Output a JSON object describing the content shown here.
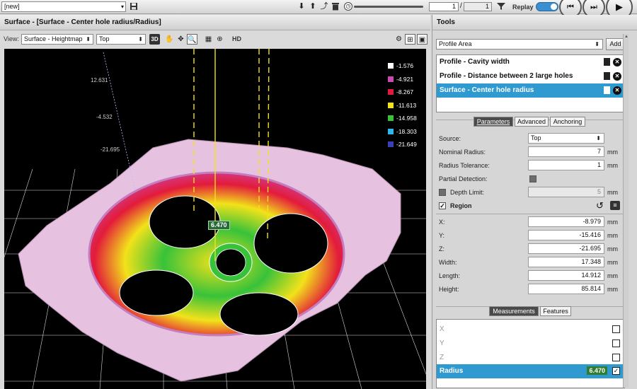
{
  "topbar": {
    "job_select": "[new]",
    "frame_current": "1",
    "frame_total": "1",
    "replay_label": "Replay"
  },
  "view_panel": {
    "title": "Surface - [Surface - Center hole radius/Radius]",
    "view_label": "View:",
    "view_mode": "Surface - Heightmap",
    "view_source": "Top",
    "btn_3d": "3D",
    "btn_hd": "HD"
  },
  "legend": [
    {
      "label": "-1.576",
      "color": "#ffffff"
    },
    {
      "label": "-4.921",
      "color": "#c84bb0"
    },
    {
      "label": "-8.267",
      "color": "#e31b3a"
    },
    {
      "label": "-11.613",
      "color": "#f2e21a"
    },
    {
      "label": "-14.958",
      "color": "#38c23a"
    },
    {
      "label": "-18.303",
      "color": "#2fb7e8"
    },
    {
      "label": "-21.649",
      "color": "#3a3fb5"
    }
  ],
  "axis_labels": [
    "12.631",
    "-4.532",
    "-21.695"
  ],
  "measurement_tag": "6.470",
  "tools": {
    "title": "Tools",
    "area_select": "Profile Area",
    "add_label": "Add",
    "items": [
      {
        "label": "Profile - Cavity width"
      },
      {
        "label": "Profile - Distance between 2 large holes"
      },
      {
        "label": "Surface - Center hole radius"
      }
    ]
  },
  "config_tabs": [
    "Parameters",
    "Advanced",
    "Anchoring"
  ],
  "params": {
    "source_label": "Source:",
    "source_value": "Top",
    "nominal_label": "Nominal Radius:",
    "nominal_value": "7",
    "tolerance_label": "Radius Tolerance:",
    "tolerance_value": "1",
    "partial_label": "Partial Detection:",
    "depth_label": "Depth Limit:",
    "depth_value": "5",
    "region_label": "Region",
    "unit": "mm",
    "region": [
      {
        "label": "X:",
        "value": "-8.979"
      },
      {
        "label": "Y:",
        "value": "-15.416"
      },
      {
        "label": "Z:",
        "value": "-21.695"
      },
      {
        "label": "Width:",
        "value": "17.348"
      },
      {
        "label": "Length:",
        "value": "14.912"
      },
      {
        "label": "Height:",
        "value": "85.814"
      }
    ]
  },
  "output_tabs": [
    "Measurements",
    "Features"
  ],
  "measurements": [
    {
      "label": "X"
    },
    {
      "label": "Y"
    },
    {
      "label": "Z"
    },
    {
      "label": "Radius",
      "value": "6.470"
    }
  ],
  "colors": {
    "selection_blue": "#2f9ad0",
    "value_green": "#2e7d32",
    "part_pink": "#e6c2e0"
  }
}
